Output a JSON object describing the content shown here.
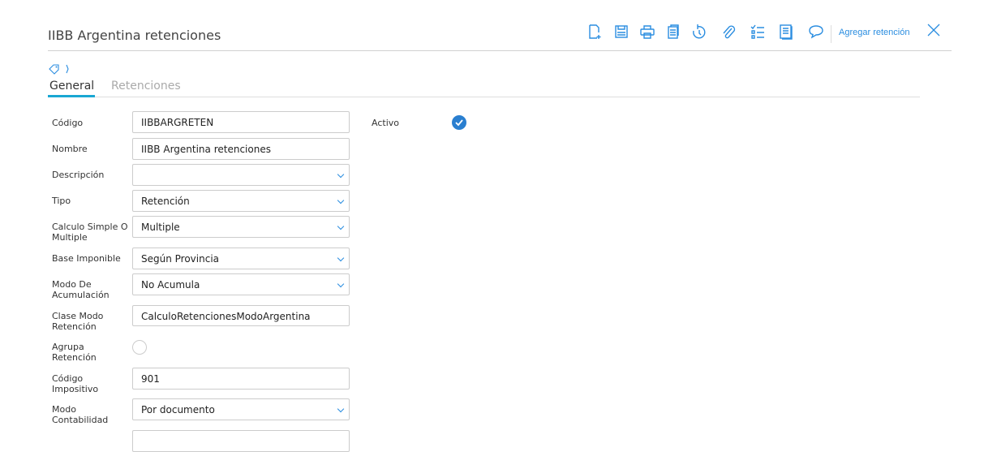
{
  "header": {
    "title": "IIBB Argentina retenciones",
    "add_label": "Agregar retención",
    "toolbar_icons": [
      "new-document-icon",
      "save-icon",
      "print-icon",
      "copy-icon",
      "history-icon",
      "attachment-icon",
      "checklist-icon",
      "document-view-icon",
      "comment-icon"
    ]
  },
  "tabs": [
    {
      "label": "General",
      "active": true
    },
    {
      "label": "Retenciones",
      "active": false
    }
  ],
  "form": {
    "codigo": {
      "label": "Código",
      "value": "IIBBARGRETEN"
    },
    "nombre": {
      "label": "Nombre",
      "value": "IIBB Argentina retenciones"
    },
    "descripcion": {
      "label": "Descripción",
      "value": ""
    },
    "tipo": {
      "label": "Tipo",
      "value": "Retención"
    },
    "calculo": {
      "label": "Calculo Simple O Multiple",
      "value": "Multiple"
    },
    "base": {
      "label": "Base Imponible",
      "value": "Según Provincia"
    },
    "modo_acum": {
      "label": "Modo De Acumulación",
      "value": "No Acumula"
    },
    "clase": {
      "label": "Clase Modo Retención",
      "value": "CalculoRetencionesModoArgentina"
    },
    "agrupa": {
      "label": "Agrupa Retención",
      "checked": false
    },
    "cod_imp": {
      "label": "Código Impositivo",
      "value": "901"
    },
    "modo_cont": {
      "label": "Modo Contabilidad",
      "value": "Por documento"
    },
    "activo": {
      "label": "Activo",
      "checked": true
    }
  }
}
